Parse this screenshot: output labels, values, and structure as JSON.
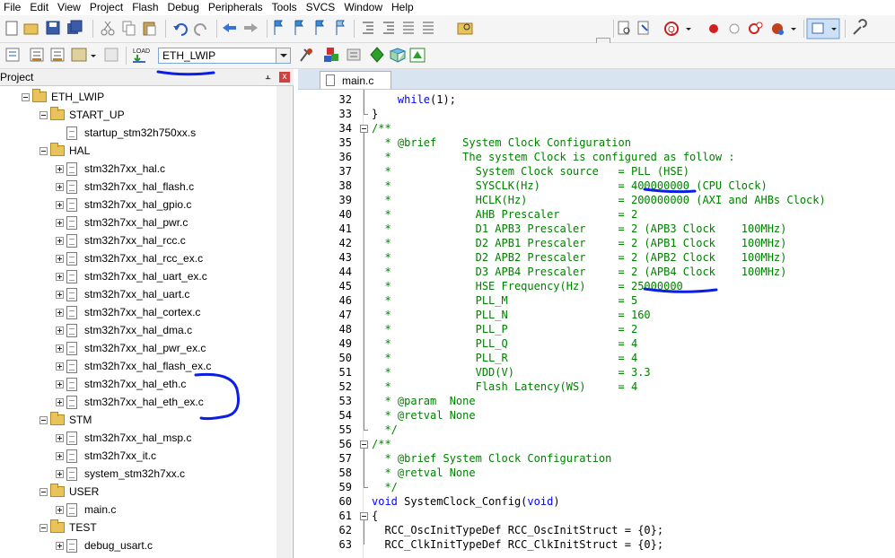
{
  "menu": [
    "File",
    "Edit",
    "View",
    "Project",
    "Flash",
    "Debug",
    "Peripherals",
    "Tools",
    "SVCS",
    "Window",
    "Help"
  ],
  "toolbar": {
    "target_value": "ETH_LWIP",
    "load_label": "LOAD"
  },
  "project_panel": {
    "title": "Project",
    "pin": "⫠",
    "close": "x",
    "tree": [
      {
        "label": "ETH_LWIP",
        "type": "root"
      },
      {
        "label": "START_UP",
        "type": "folder"
      },
      {
        "label": "startup_stm32h750xx.s",
        "type": "file",
        "expand": false
      },
      {
        "label": "HAL",
        "type": "folder"
      },
      {
        "label": "stm32h7xx_hal.c",
        "type": "file",
        "expand": true
      },
      {
        "label": "stm32h7xx_hal_flash.c",
        "type": "file",
        "expand": true
      },
      {
        "label": "stm32h7xx_hal_gpio.c",
        "type": "file",
        "expand": true
      },
      {
        "label": "stm32h7xx_hal_pwr.c",
        "type": "file",
        "expand": true
      },
      {
        "label": "stm32h7xx_hal_rcc.c",
        "type": "file",
        "expand": true
      },
      {
        "label": "stm32h7xx_hal_rcc_ex.c",
        "type": "file",
        "expand": true
      },
      {
        "label": "stm32h7xx_hal_uart_ex.c",
        "type": "file",
        "expand": true
      },
      {
        "label": "stm32h7xx_hal_uart.c",
        "type": "file",
        "expand": true
      },
      {
        "label": "stm32h7xx_hal_cortex.c",
        "type": "file",
        "expand": true
      },
      {
        "label": "stm32h7xx_hal_dma.c",
        "type": "file",
        "expand": true
      },
      {
        "label": "stm32h7xx_hal_pwr_ex.c",
        "type": "file",
        "expand": true
      },
      {
        "label": "stm32h7xx_hal_flash_ex.c",
        "type": "file",
        "expand": true
      },
      {
        "label": "stm32h7xx_hal_eth.c",
        "type": "file",
        "expand": true
      },
      {
        "label": "stm32h7xx_hal_eth_ex.c",
        "type": "file",
        "expand": true
      },
      {
        "label": "STM",
        "type": "folder"
      },
      {
        "label": "stm32h7xx_hal_msp.c",
        "type": "file",
        "expand": true
      },
      {
        "label": "stm32h7xx_it.c",
        "type": "file",
        "expand": true
      },
      {
        "label": "system_stm32h7xx.c",
        "type": "file",
        "expand": true
      },
      {
        "label": "USER",
        "type": "folder"
      },
      {
        "label": "main.c",
        "type": "file",
        "expand": true
      },
      {
        "label": "TEST",
        "type": "folder"
      },
      {
        "label": "debug_usart.c",
        "type": "file",
        "expand": true
      }
    ]
  },
  "editor": {
    "tab": "main.c",
    "lines": [
      {
        "n": "32",
        "t": "    while(1);",
        "c": "kwline"
      },
      {
        "n": "33",
        "t": "}",
        "c": ""
      },
      {
        "n": "34",
        "t": "/**",
        "c": "cm"
      },
      {
        "n": "35",
        "t": "  * @brief    System Clock Configuration",
        "c": "cm"
      },
      {
        "n": "36",
        "t": "  *           The system Clock is configured as follow :",
        "c": "cm"
      },
      {
        "n": "37",
        "t": "  *             System Clock source   = PLL (HSE)",
        "c": "cm"
      },
      {
        "n": "38",
        "t": "  *             SYSCLK(Hz)            = 400000000 (CPU Clock)",
        "c": "cm"
      },
      {
        "n": "39",
        "t": "  *             HCLK(Hz)              = 200000000 (AXI and AHBs Clock)",
        "c": "cm"
      },
      {
        "n": "40",
        "t": "  *             AHB Prescaler         = 2",
        "c": "cm"
      },
      {
        "n": "41",
        "t": "  *             D1 APB3 Prescaler     = 2 (APB3 Clock    100MHz)",
        "c": "cm"
      },
      {
        "n": "42",
        "t": "  *             D2 APB1 Prescaler     = 2 (APB1 Clock    100MHz)",
        "c": "cm"
      },
      {
        "n": "43",
        "t": "  *             D2 APB2 Prescaler     = 2 (APB2 Clock    100MHz)",
        "c": "cm"
      },
      {
        "n": "44",
        "t": "  *             D3 APB4 Prescaler     = 2 (APB4 Clock    100MHz)",
        "c": "cm"
      },
      {
        "n": "45",
        "t": "  *             HSE Frequency(Hz)     = 25000000",
        "c": "cm"
      },
      {
        "n": "46",
        "t": "  *             PLL_M                 = 5",
        "c": "cm"
      },
      {
        "n": "47",
        "t": "  *             PLL_N                 = 160",
        "c": "cm"
      },
      {
        "n": "48",
        "t": "  *             PLL_P                 = 2",
        "c": "cm"
      },
      {
        "n": "49",
        "t": "  *             PLL_Q                 = 4",
        "c": "cm"
      },
      {
        "n": "50",
        "t": "  *             PLL_R                 = 4",
        "c": "cm"
      },
      {
        "n": "51",
        "t": "  *             VDD(V)                = 3.3",
        "c": "cm"
      },
      {
        "n": "52",
        "t": "  *             Flash Latency(WS)     = 4",
        "c": "cm"
      },
      {
        "n": "53",
        "t": "  * @param  None",
        "c": "cm"
      },
      {
        "n": "54",
        "t": "  * @retval None",
        "c": "cm"
      },
      {
        "n": "55",
        "t": "  */",
        "c": "cm"
      },
      {
        "n": "56",
        "t": "/**",
        "c": "cm"
      },
      {
        "n": "57",
        "t": "  * @brief System Clock Configuration",
        "c": "cm"
      },
      {
        "n": "58",
        "t": "  * @retval None",
        "c": "cm"
      },
      {
        "n": "59",
        "t": "  */",
        "c": "cm"
      },
      {
        "n": "60",
        "t": "void SystemClock_Config(void)",
        "c": "voidline"
      },
      {
        "n": "61",
        "t": "{",
        "c": ""
      },
      {
        "n": "62",
        "t": "  RCC_OscInitTypeDef RCC_OscInitStruct = {0};",
        "c": ""
      },
      {
        "n": "63",
        "t": "  RCC_ClkInitTypeDef RCC_ClkInitStruct = {0};",
        "c": ""
      }
    ]
  },
  "colors": {
    "comment": "#008000",
    "keyword": "#0000ff",
    "annotation": "#0a1ee6"
  }
}
